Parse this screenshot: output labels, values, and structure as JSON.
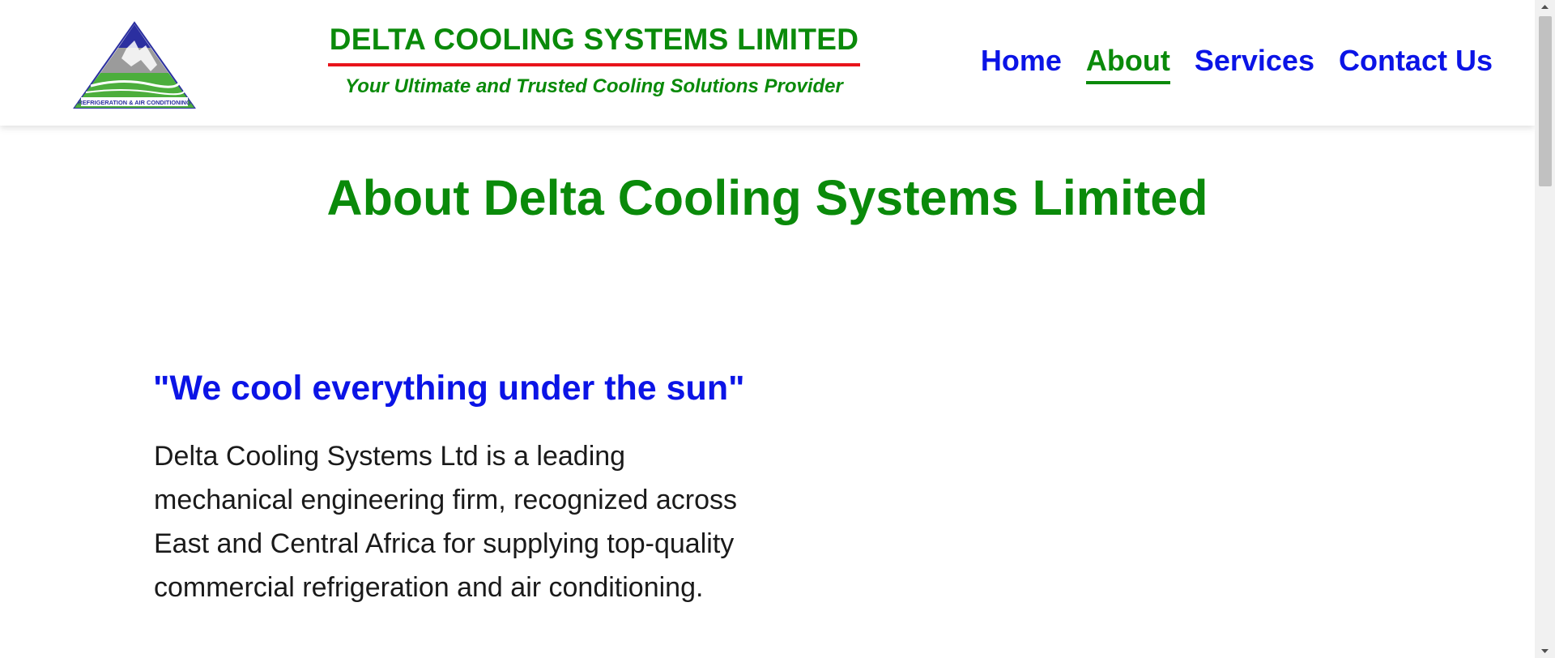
{
  "header": {
    "logo": {
      "caption": "REFRIGERATION & AIR CONDITIONING",
      "colors": {
        "triangle_top": "#2b2fa0",
        "mountain": "#9b9b9b",
        "field": "#4cae3c",
        "border": "#2b2fa0"
      }
    },
    "brand_name": "DELTA COOLING SYSTEMS LIMITED",
    "tagline": "Your Ultimate and Trusted Cooling Solutions Provider"
  },
  "nav": {
    "items": [
      {
        "label": "Home",
        "active": false
      },
      {
        "label": "About",
        "active": true
      },
      {
        "label": "Services",
        "active": false
      },
      {
        "label": "Contact Us",
        "active": false
      }
    ]
  },
  "main": {
    "title": "About Delta Cooling Systems Limited",
    "quote": "\"We cool everything under the sun\"",
    "body": "Delta Cooling Systems Ltd is a leading mechanical engineering firm, recognized across East and Central Africa for supplying top-quality commercial refrigeration and air conditioning."
  },
  "colors": {
    "brand_green": "#0a8a0a",
    "link_blue": "#0b14e6",
    "accent_red": "#e8141b",
    "body_text": "#1a1a1a"
  }
}
